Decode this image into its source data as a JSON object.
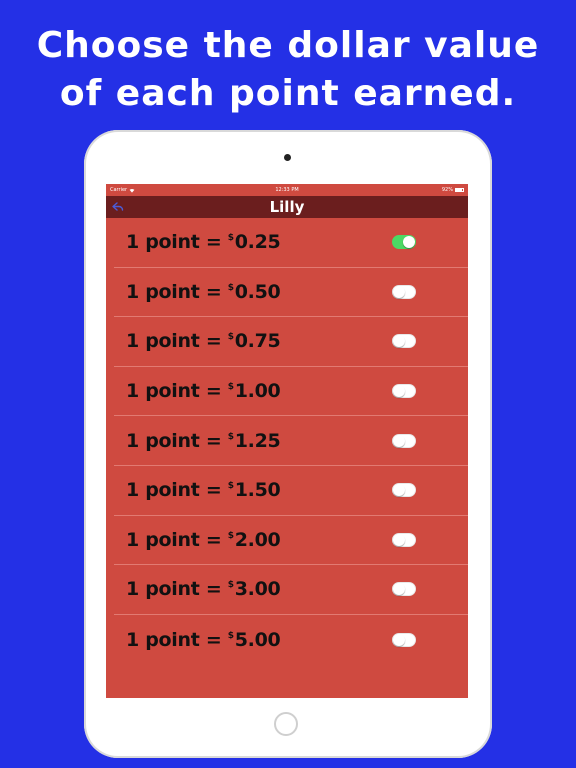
{
  "headline": {
    "line1": "Choose the dollar value",
    "line2": "of each point earned."
  },
  "statusbar": {
    "carrier": "Carrier",
    "time": "12:33 PM",
    "battery": "92%"
  },
  "navbar": {
    "title": "Lilly"
  },
  "colors": {
    "background": "#2430e6",
    "screen": "#cf4a40",
    "navbar": "#6b1e1e",
    "toggle_on": "#4cd964"
  },
  "options": [
    {
      "prefix": "1 point = ",
      "currency": "$",
      "amount": "0.25",
      "enabled": true
    },
    {
      "prefix": "1 point = ",
      "currency": "$",
      "amount": "0.50",
      "enabled": false
    },
    {
      "prefix": "1 point = ",
      "currency": "$",
      "amount": "0.75",
      "enabled": false
    },
    {
      "prefix": "1 point = ",
      "currency": "$",
      "amount": "1.00",
      "enabled": false
    },
    {
      "prefix": "1 point = ",
      "currency": "$",
      "amount": "1.25",
      "enabled": false
    },
    {
      "prefix": "1 point = ",
      "currency": "$",
      "amount": "1.50",
      "enabled": false
    },
    {
      "prefix": "1 point = ",
      "currency": "$",
      "amount": "2.00",
      "enabled": false
    },
    {
      "prefix": "1 point = ",
      "currency": "$",
      "amount": "3.00",
      "enabled": false
    },
    {
      "prefix": "1 point = ",
      "currency": "$",
      "amount": "5.00",
      "enabled": false
    }
  ]
}
